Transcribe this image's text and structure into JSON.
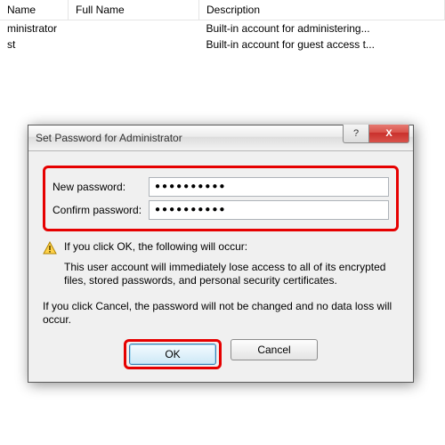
{
  "table": {
    "headers": [
      "Name",
      "Full Name",
      "Description"
    ],
    "rows": [
      {
        "name": "ministrator",
        "full": "",
        "desc": "Built-in account for administering..."
      },
      {
        "name": "st",
        "full": "",
        "desc": "Built-in account for guest access t..."
      }
    ]
  },
  "dialog": {
    "title": "Set Password for Administrator",
    "help_glyph": "?",
    "close_glyph": "X",
    "new_label": "New password:",
    "confirm_label": "Confirm password:",
    "pwd_mask": "●●●●●●●●●●",
    "warn_line": "If you click OK, the following will occur:",
    "warn_detail": "This user account will immediately lose access to all of its encrypted files, stored passwords, and personal security certificates.",
    "cancel_line": "If you click Cancel, the password will not be changed and no data loss will occur.",
    "ok_label": "OK",
    "cancel_label": "Cancel"
  }
}
